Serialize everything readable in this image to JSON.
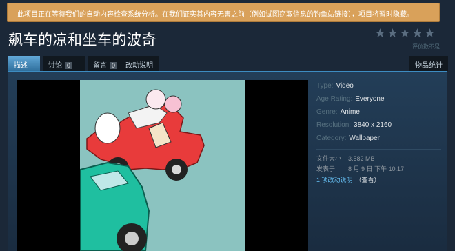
{
  "notice": {
    "text": "此项目正在等待我们的自动内容检查系统分析。在我们证实其内容无害之前（例如试图窃取信息的钓鱼站链接），项目将暂时隐藏。"
  },
  "page": {
    "title": "飙车的凉和坐车的波奇"
  },
  "rating": {
    "stars": 5,
    "filled": 0,
    "text": "评价数不足"
  },
  "tabs": [
    {
      "label": "描述"
    },
    {
      "label": "讨论",
      "count": "0"
    },
    {
      "label": "留言",
      "count": "0"
    },
    {
      "label": "改动说明"
    }
  ],
  "stats_tab": {
    "label": "物品统计"
  },
  "details": [
    {
      "key": "Type:",
      "value": "Video"
    },
    {
      "key": "Age Rating:",
      "value": "Everyone"
    },
    {
      "key": "Genre:",
      "value": "Anime"
    },
    {
      "key": "Resolution:",
      "value": "3840 x 2160"
    },
    {
      "key": "Category:",
      "value": "Wallpaper"
    }
  ],
  "meta": [
    {
      "key": "文件大小",
      "value": "3.582 MB"
    },
    {
      "key": "发表于",
      "value": "8 月 9 日 下午 10:17"
    }
  ],
  "changes": {
    "link": "1 项改动说明",
    "view": "（查看）"
  },
  "colors": {
    "background": "#1b2838",
    "accent": "#3d8cc1",
    "notice": "#d9a15a",
    "link": "#66c0f4"
  },
  "icons": {
    "star": "star-icon"
  }
}
